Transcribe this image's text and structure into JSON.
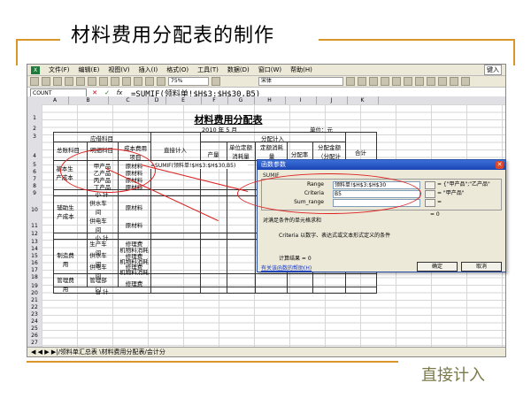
{
  "slide": {
    "title": "材料费用分配表的制作",
    "footer_note": "直接计入"
  },
  "excel": {
    "menu": [
      "文件(F)",
      "编辑(E)",
      "视图(V)",
      "插入(I)",
      "格式(O)",
      "工具(T)",
      "数据(D)",
      "窗口(W)",
      "帮助(H)"
    ],
    "help_box": "键入",
    "font_box": "宋体",
    "zoom_box": "75%",
    "name_box": "COUNT",
    "formula_text": "=SUMIF(领料单!$H$3:$H$30,B5)",
    "columns": [
      "A",
      "B",
      "C",
      "D",
      "E",
      "F",
      "G",
      "H",
      "I",
      "J",
      "K"
    ],
    "rows": [
      "1",
      "2",
      "3",
      "4",
      "5",
      "6",
      "7",
      "8",
      "9",
      "10",
      "11",
      "12",
      "13",
      "14",
      "15",
      "16",
      "17",
      "18",
      "19",
      "20",
      "21",
      "22",
      "23",
      "24",
      "25",
      "26",
      "27",
      "28",
      "29",
      "30",
      "31",
      "32",
      "33",
      "34"
    ],
    "sheet_tabs": "◀ ◀ ▶ ▶|/领料单汇总表 \\材料费用分配表/会计分",
    "table": {
      "title": "材料费用分配表",
      "date": "2010 年 5 月",
      "unit": "单位：元",
      "h_accounts": "应借科目",
      "h_direct": "直接计入",
      "h_alloc": "分配计入",
      "h_total": "合计",
      "h_total_acct": "总账科目",
      "h_detail_acct": "明细科目",
      "h_cost_item": "成本费用项目",
      "h_output": "产量",
      "h_unit_quota": "单位定额消耗量",
      "h_quota": "定额消耗量",
      "h_rate": "分配率",
      "h_amount": "分配金额（分配计入）",
      "basic_prod": "基本生产成本",
      "prod_a": "甲产品",
      "prod_b": "乙产品",
      "prod_c": "丙产品",
      "prod_d": "丁产品",
      "raw_mat": "原材料",
      "subtotal": "小 计",
      "aux_prod": "辅助生产成本",
      "water": "供水车间",
      "power": "供电车间",
      "mfg": "制造费用",
      "prod_ws": "生产车间",
      "supply_ws": "供水车间",
      "elec_ws": "供电车间",
      "repair": "修理费",
      "mach_mat": "机物料消耗",
      "mgmt": "管理费用",
      "mgmt_dept": "管理部门",
      "total": "合 计",
      "e5_formula": "=SUMIF(领料单!$H$3:$H$30,B5)"
    }
  },
  "dialog": {
    "title": "函数参数",
    "fn_name": "SUMIF",
    "range_label": "Range",
    "range_value": "领料单!$H$3:$H$30",
    "range_preview": "= {\"甲产品\";\"乙产品\"",
    "criteria_label": "Criteria",
    "criteria_value": "B5",
    "criteria_preview": "= \"甲产品\"",
    "sum_label": "Sum_range",
    "sum_value": "",
    "sum_preview": "=",
    "result_eq": "= 0",
    "description": "对满足条件的单元格求和",
    "param_help": "Criteria     以数字、表达式或文本形式定义的条件",
    "calc_result": "计算结果 =          0",
    "help_link": "有关该函数的帮助(H)",
    "ok": "确定",
    "cancel": "取消"
  }
}
